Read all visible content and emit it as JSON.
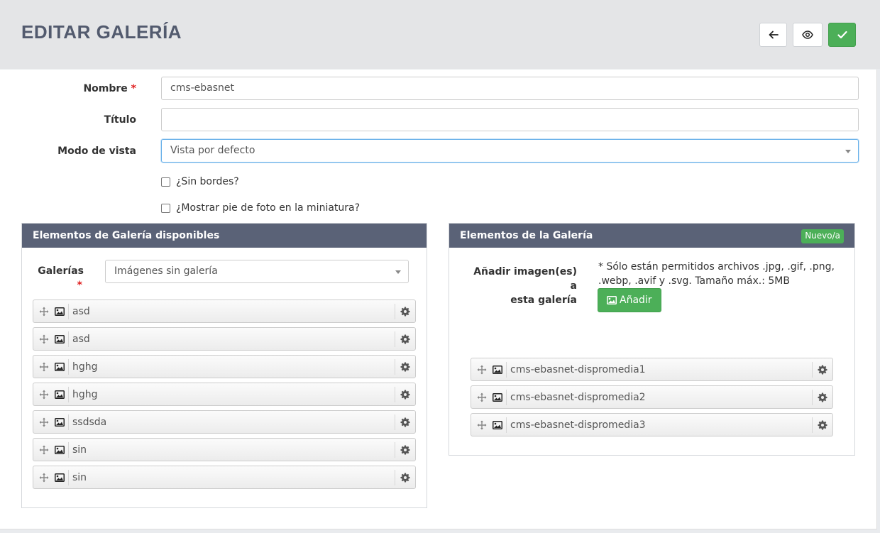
{
  "page": {
    "title": "EDITAR GALERÍA"
  },
  "toolbar": {
    "back_icon": "arrow-left-icon",
    "view_icon": "eye-icon",
    "save_icon": "check-icon"
  },
  "form": {
    "nombre": {
      "label": "Nombre",
      "required_mark": "*",
      "value": "cms-ebasnet"
    },
    "titulo": {
      "label": "Título",
      "value": ""
    },
    "modo_vista": {
      "label": "Modo de vista",
      "value": "Vista por defecto"
    },
    "sin_bordes": {
      "label": "¿Sin bordes?",
      "checked": false
    },
    "mostrar_pie": {
      "label": "¿Mostrar pie de foto en la miniatura?",
      "checked": false
    }
  },
  "available_panel": {
    "title": "Elementos de Galería disponibles",
    "galerias_label": "Galerías",
    "required_mark": "*",
    "galerias_value": "Imágenes sin galería",
    "items": [
      {
        "label": "asd"
      },
      {
        "label": "asd"
      },
      {
        "label": "hghg"
      },
      {
        "label": "hghg"
      },
      {
        "label": "ssdsda"
      },
      {
        "label": "sin"
      },
      {
        "label": "sin"
      }
    ]
  },
  "gallery_panel": {
    "title": "Elementos de la Galería",
    "badge": "Nuevo/a",
    "add_label_line1": "Añadir imagen(es) a",
    "add_label_line2": "esta galería",
    "note_line1": "* Sólo están permitidos archivos .jpg, .gif, .png,",
    "note_line2": ".webp, .avif y .svg. Tamaño máx.: 5MB",
    "add_button": "Añadir",
    "items": [
      {
        "label": "cms-ebasnet-dispromedia1"
      },
      {
        "label": "cms-ebasnet-dispromedia2"
      },
      {
        "label": "cms-ebasnet-dispromedia3"
      }
    ]
  },
  "colors": {
    "header_bg": "#e4e5e7",
    "title": "#525a6e",
    "panel_head": "#5a6277",
    "success": "#4caf58",
    "required": "#e02020"
  }
}
